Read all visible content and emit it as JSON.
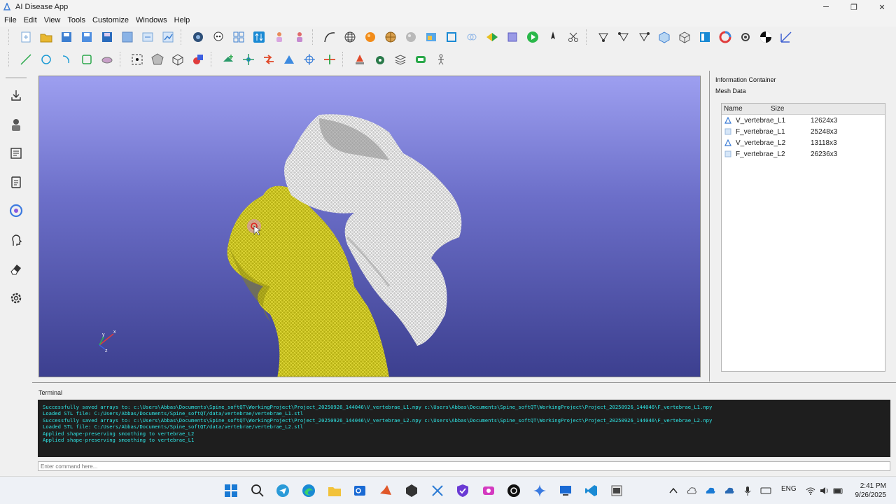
{
  "window": {
    "title": "AI Disease App",
    "minimize": "─",
    "maximize": "❐",
    "close": "✕"
  },
  "menu": [
    "File",
    "Edit",
    "View",
    "Tools",
    "Customize",
    "Windows",
    "Help"
  ],
  "info_panel": {
    "header": "Information Container",
    "section": "Mesh Data",
    "columns": [
      "Name",
      "Size"
    ],
    "rows": [
      {
        "name": "V_vertebrae_L1",
        "size": "12624x3",
        "icon": "vertices-icon"
      },
      {
        "name": "F_vertebrae_L1",
        "size": "25248x3",
        "icon": "faces-icon"
      },
      {
        "name": "V_vertebrae_L2",
        "size": "13118x3",
        "icon": "vertices-icon"
      },
      {
        "name": "F_vertebrae_L2",
        "size": "26236x3",
        "icon": "faces-icon"
      }
    ]
  },
  "terminal": {
    "label": "Terminal",
    "lines": [
      "Successfully saved arrays to: c:\\Users\\Abbas\\Documents\\Spine_softQT\\WorkingProject\\Project_20250926_144046\\V_vertebrae_L1.npy c:\\Users\\Abbas\\Documents\\Spine_softQT\\WorkingProject\\Project_20250926_144046\\F_vertebrae_L1.npy",
      "Loaded STL file: C:/Users/Abbas/Documents/Spine_softQT/data/vertebrae/vertebrae_L1.stl",
      "Successfully saved arrays to: c:\\Users\\Abbas\\Documents\\Spine_softQT\\WorkingProject\\Project_20250926_144046\\V_vertebrae_L2.npy c:\\Users\\Abbas\\Documents\\Spine_softQT\\WorkingProject\\Project_20250926_144046\\F_vertebrae_L2.npy",
      "Loaded STL file: C:/Users/Abbas/Documents/Spine_softQT/data/vertebrae/vertebrae_L2.stl",
      "Applied shape-preserving smoothing to vertebrae_L2",
      "Applied shape-preserving smoothing to vertebrae_L1"
    ],
    "input_placeholder": "Enter command here..."
  },
  "axes": {
    "x": "x",
    "y": "y",
    "z": "z"
  },
  "taskbar": {
    "language": "ENG",
    "time": "2:41 PM",
    "date": "9/26/2025"
  },
  "colors": {
    "viewport_top": "#9d9ff0",
    "viewport_bottom": "#3c3f8f",
    "mesh_gray": "#cfcfcf",
    "mesh_yellow": "#c9c21a",
    "terminal_text": "#2ee6e6"
  }
}
